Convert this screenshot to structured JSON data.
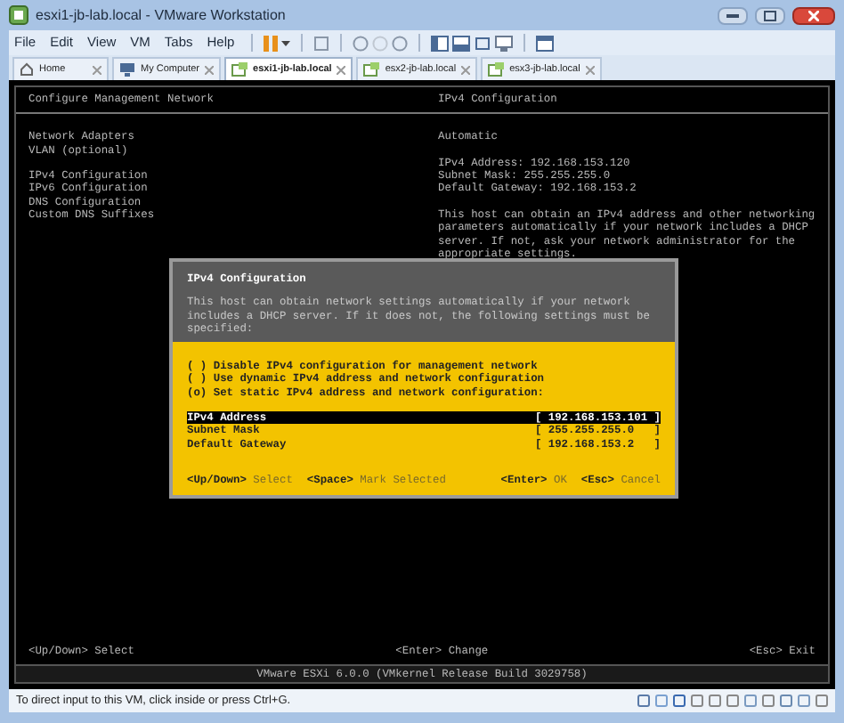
{
  "window": {
    "title": "esxi1-jb-lab.local - VMware Workstation"
  },
  "menu": [
    "File",
    "Edit",
    "View",
    "VM",
    "Tabs",
    "Help"
  ],
  "tabs": [
    {
      "label": "Home",
      "kind": "home",
      "selected": false
    },
    {
      "label": "My Computer",
      "kind": "computer",
      "selected": false
    },
    {
      "label": "esxi1-jb-lab.local",
      "kind": "vm",
      "selected": true
    },
    {
      "label": "esx2-jb-lab.local",
      "kind": "vm",
      "selected": false
    },
    {
      "label": "esx3-jb-lab.local",
      "kind": "vm",
      "selected": false
    }
  ],
  "console": {
    "header_left": "Configure Management Network",
    "header_right": "IPv4 Configuration",
    "menu_groups": [
      [
        "Network Adapters",
        "VLAN (optional)"
      ],
      [
        "IPv4 Configuration",
        "IPv6 Configuration",
        "DNS Configuration",
        "Custom DNS Suffixes"
      ]
    ],
    "detail_groups": [
      [
        "Automatic"
      ],
      [
        "IPv4 Address: 192.168.153.120",
        "Subnet Mask: 255.255.255.0",
        "Default Gateway: 192.168.153.2"
      ],
      [
        "This host can obtain an IPv4 address and other networking",
        "parameters automatically if your network includes a DHCP",
        "server. If not, ask your network administrator for the",
        "appropriate settings."
      ]
    ],
    "hints": [
      {
        "key": "<Up/Down>",
        "action": "Select"
      },
      {
        "key": "<Enter>",
        "action": "Change"
      },
      {
        "key": "<Esc>",
        "action": "Exit"
      }
    ],
    "footer": "VMware ESXi 6.0.0 (VMkernel Release Build 3029758)"
  },
  "dialog": {
    "title": "IPv4 Configuration",
    "description": [
      "This host can obtain network settings automatically if your network",
      "includes a DHCP server. If it does not, the following settings must be",
      "specified:"
    ],
    "options": [
      "( ) Disable IPv4 configuration for management network",
      "( ) Use dynamic IPv4 address and network configuration",
      "(o) Set static IPv4 address and network configuration:"
    ],
    "fields": [
      {
        "label": "IPv4 Address",
        "value": "[ 192.168.153.101 ]",
        "selected": true
      },
      {
        "label": "Subnet Mask",
        "value": "[ 255.255.255.0   ]",
        "selected": false
      },
      {
        "label": "Default Gateway",
        "value": "[ 192.168.153.2   ]",
        "selected": false
      }
    ],
    "hints_left": [
      {
        "key": "<Up/Down>",
        "action": "Select"
      },
      {
        "key": "<Space>",
        "action": "Mark Selected"
      }
    ],
    "hints_right": [
      {
        "key": "<Enter>",
        "action": "OK"
      },
      {
        "key": "<Esc>",
        "action": "Cancel"
      }
    ]
  },
  "status_bar": {
    "text": "To direct input to this VM, click inside or press Ctrl+G."
  }
}
